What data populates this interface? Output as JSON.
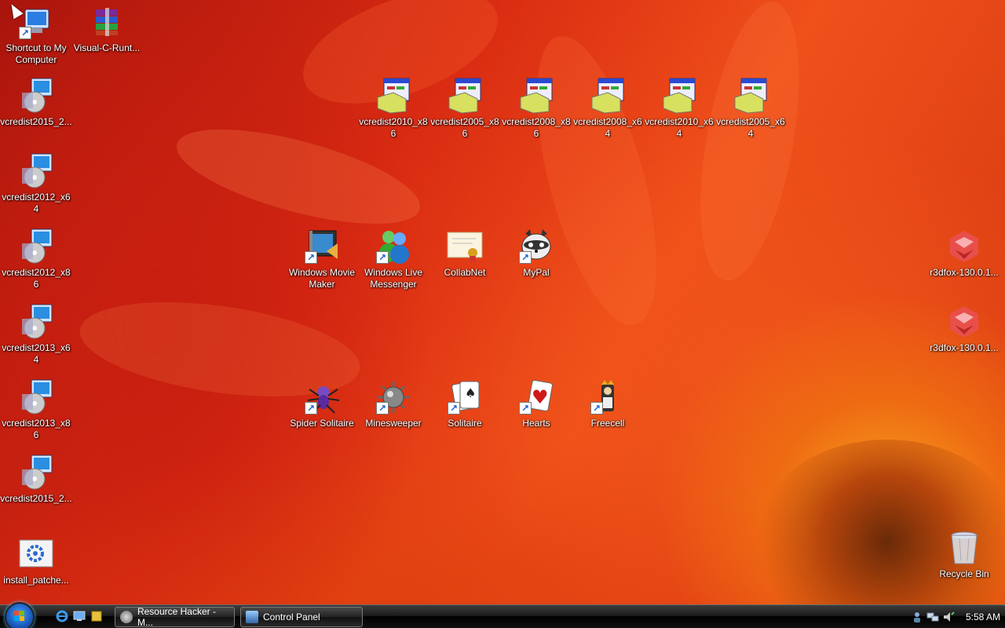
{
  "desktop": {
    "icons": [
      {
        "label": "Shortcut to My Computer",
        "type": "computer",
        "shortcut": true
      },
      {
        "label": "Visual-C-Runt...",
        "type": "rar",
        "shortcut": false
      },
      {
        "label": "vcredist2015_2...",
        "type": "installer",
        "shortcut": false
      },
      {
        "label": "vcredist2012_x64",
        "type": "installer",
        "shortcut": false
      },
      {
        "label": "vcredist2012_x86",
        "type": "installer",
        "shortcut": false
      },
      {
        "label": "vcredist2013_x64",
        "type": "installer",
        "shortcut": false
      },
      {
        "label": "vcredist2013_x86",
        "type": "installer",
        "shortcut": false
      },
      {
        "label": "vcredist2015_2...",
        "type": "installer",
        "shortcut": false
      },
      {
        "label": "install_patche...",
        "type": "script",
        "shortcut": false
      },
      {
        "label": "vcredist2010_x86",
        "type": "setup",
        "shortcut": false
      },
      {
        "label": "vcredist2005_x86",
        "type": "setup",
        "shortcut": false
      },
      {
        "label": "vcredist2008_x86",
        "type": "setup",
        "shortcut": false
      },
      {
        "label": "vcredist2008_x64",
        "type": "setup",
        "shortcut": false
      },
      {
        "label": "vcredist2010_x64",
        "type": "setup",
        "shortcut": false
      },
      {
        "label": "vcredist2005_x64",
        "type": "setup",
        "shortcut": false
      },
      {
        "label": "Windows Movie Maker",
        "type": "moviemaker",
        "shortcut": true
      },
      {
        "label": "Windows Live Messenger",
        "type": "messenger",
        "shortcut": true
      },
      {
        "label": "CollabNet",
        "type": "certificate",
        "shortcut": false
      },
      {
        "label": "MyPal",
        "type": "mypal",
        "shortcut": true
      },
      {
        "label": "Spider Solitaire",
        "type": "spider",
        "shortcut": true
      },
      {
        "label": "Minesweeper",
        "type": "mine",
        "shortcut": true
      },
      {
        "label": "Solitaire",
        "type": "cards",
        "shortcut": true
      },
      {
        "label": "Hearts",
        "type": "hearts",
        "shortcut": true
      },
      {
        "label": "Freecell",
        "type": "freecell",
        "shortcut": true
      },
      {
        "label": "r3dfox-130.0.1...",
        "type": "r3dfox",
        "shortcut": false
      },
      {
        "label": "r3dfox-130.0.1...",
        "type": "r3dfox",
        "shortcut": false
      },
      {
        "label": "Recycle Bin",
        "type": "recycle",
        "shortcut": false
      }
    ]
  },
  "taskbar": {
    "buttons": [
      {
        "label": "Resource Hacker - M..."
      },
      {
        "label": "Control Panel"
      }
    ],
    "clock": "5:58 AM"
  }
}
